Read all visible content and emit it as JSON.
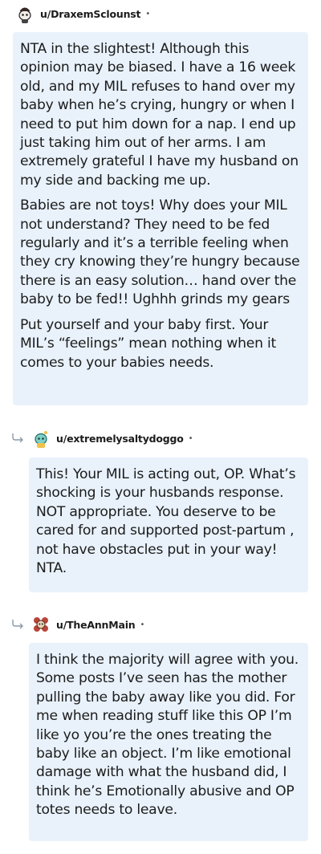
{
  "comments": [
    {
      "username": "u/DraxemSclounst",
      "separator": "•",
      "paragraphs": [
        "NTA in the slightest! Although this opinion may be biased. I have a 16 week old, and my MIL refuses to hand over my baby when he’s crying, hungry or when I need to put him down for a nap. I end up just taking him out of her arms. I am extremely grateful I have my husband on my side and backing me up.",
        "Babies are not toys! Why does your MIL not understand? They need to be fed regularly and it’s a terrible feeling when they cry knowing they’re hungry because there is an easy solution… hand over the baby to be fed!! Ughhh grinds my gears",
        "Put yourself and your baby first. Your MIL’s “feelings” mean nothing when it comes to your babies needs."
      ]
    },
    {
      "username": "u/extremelysaltydoggo",
      "separator": "•",
      "paragraphs": [
        "This! Your MIL is acting out, OP. What’s shocking is your husbands response. NOT appropriate. You deserve to be cared for and supported post-partum , not have obstacles put in your way! NTA."
      ]
    },
    {
      "username": "u/TheAnnMain",
      "separator": "•",
      "paragraphs": [
        "I think the majority will agree with you. Some posts I’ve seen has the mother pulling the baby away like you did. For me when reading stuff like this OP I’m like yo you’re the ones treating the baby like an object. I’m like emotional damage with what the husband did, I think he’s Emotionally abusive and OP totes needs to leave."
      ]
    }
  ],
  "icons": {
    "avatar_1": "avatar-snoo-icon",
    "avatar_2": "avatar-snoo-teal-icon",
    "avatar_3": "avatar-snoo-flower-icon",
    "reply": "reply-arrow-icon"
  },
  "colors": {
    "bubble": "#e9f2fb",
    "text": "#1c1c1c"
  }
}
